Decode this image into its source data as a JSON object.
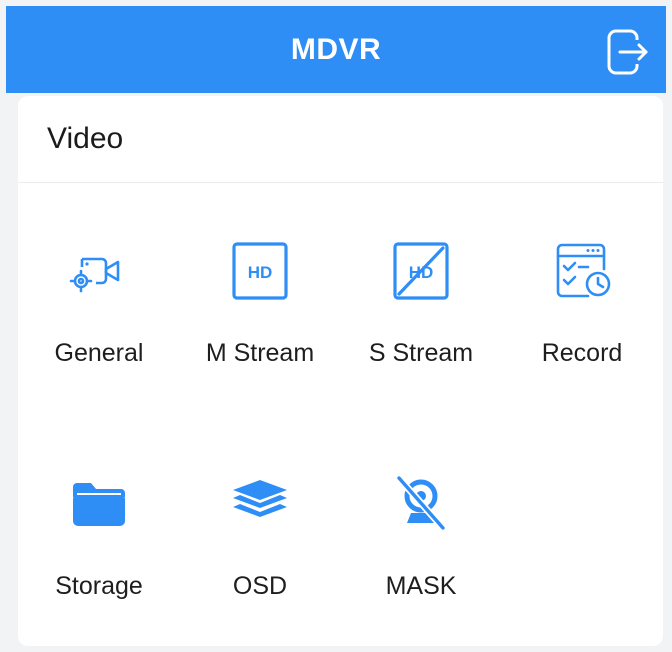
{
  "header": {
    "title": "MDVR",
    "exit_icon": "exit-icon",
    "bg_color": "#2f8ef5"
  },
  "section": {
    "title": "Video",
    "items": [
      {
        "label": "General",
        "icon": "camera-settings-icon"
      },
      {
        "label": "M Stream",
        "icon": "hd-icon"
      },
      {
        "label": "S Stream",
        "icon": "hd-off-icon"
      },
      {
        "label": "Record",
        "icon": "record-schedule-icon"
      },
      {
        "label": "Storage",
        "icon": "folder-icon"
      },
      {
        "label": "OSD",
        "icon": "layers-icon"
      },
      {
        "label": "MASK",
        "icon": "webcam-off-icon"
      }
    ]
  },
  "accent_color": "#2f8ef5"
}
